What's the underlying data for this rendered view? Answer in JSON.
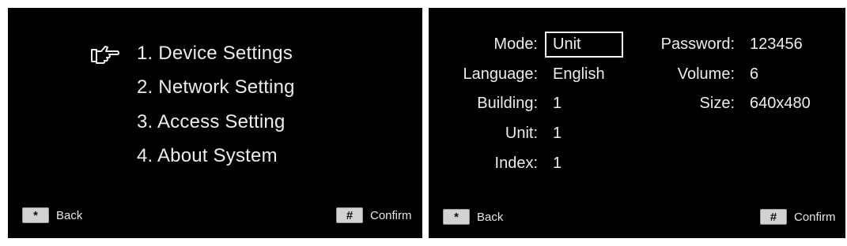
{
  "main_menu": {
    "items": [
      {
        "label": "1. Device Settings"
      },
      {
        "label": "2. Network Setting"
      },
      {
        "label": "3. Access Setting"
      },
      {
        "label": "4. About System"
      }
    ],
    "pointer_icon": "pointing-hand-icon",
    "selected_index": 0
  },
  "left_footer": {
    "back_key": "*",
    "back_label": "Back",
    "confirm_key": "#",
    "confirm_label": "Confirm"
  },
  "device_settings": {
    "mode_label": "Mode:",
    "mode_value": "Unit",
    "language_label": "Language:",
    "language_value": "English",
    "building_label": "Building:",
    "building_value": "1",
    "unit_label": "Unit:",
    "unit_value": "1",
    "index_label": "Index:",
    "index_value": "1",
    "password_label": "Password:",
    "password_value": "123456",
    "volume_label": "Volume:",
    "volume_value": "6",
    "size_label": "Size:",
    "size_value": "640x480"
  },
  "right_footer": {
    "back_key": "*",
    "back_label": "Back",
    "confirm_key": "#",
    "confirm_label": "Confirm"
  },
  "colors": {
    "screen_background": "#000000",
    "text": "#ececec",
    "key_background": "#d2d2d2"
  }
}
